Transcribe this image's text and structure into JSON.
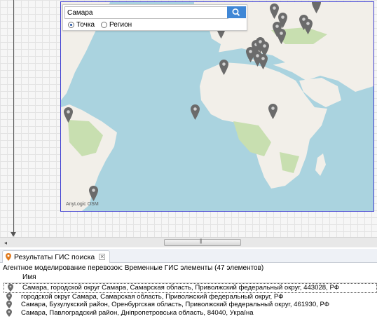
{
  "search": {
    "value": "Самара",
    "options": [
      {
        "label": "Точка",
        "selected": true
      },
      {
        "label": "Регион",
        "selected": false
      }
    ]
  },
  "map": {
    "attribution": "AnyLogic OSM"
  },
  "results_panel": {
    "tab_label": "Результаты ГИС поиска",
    "summary": "Агентное моделирование перевозок: Временные ГИС элементы (47 элементов)",
    "column_header": "Имя",
    "rows": [
      "Самара, городской округ Самара, Самарская область, Приволжский федеральный округ, 443028, РФ",
      "городской округ Самара, Самарская область, Приволжский федеральный округ, РФ",
      "Самара, Бузулукский район, Оренбургская область, Приволжский федеральный округ, 461930, РФ",
      "Самара, Павлоградский район, Днiпропетровська область, 84040, Україна"
    ]
  },
  "colors": {
    "water": "#aad3df",
    "land": "#f2efe9",
    "green": "#c8dfb0",
    "pin": "#6b6b6b",
    "map_border": "#3b3bd0",
    "search_button": "#3f87d6"
  }
}
